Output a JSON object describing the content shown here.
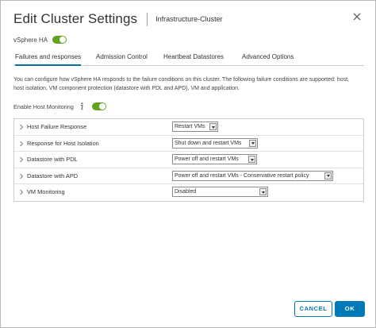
{
  "dialog": {
    "title": "Edit Cluster Settings",
    "subtitle": "Infrastructure-Cluster",
    "close_icon": "close-icon"
  },
  "vsphere_ha": {
    "label": "vSphere HA",
    "enabled": true
  },
  "tabs": [
    {
      "label": "Failures and responses",
      "active": true
    },
    {
      "label": "Admission Control",
      "active": false
    },
    {
      "label": "Heartbeat Datastores",
      "active": false
    },
    {
      "label": "Advanced Options",
      "active": false
    }
  ],
  "description": "You can configure how vSphere HA responds to the failure conditions on this cluster. The following failure conditions are supported: host, host isolation, VM component protection (datastore with PDL and APD), VM and application.",
  "host_monitoring": {
    "label": "Enable Host Monitoring",
    "info_icon": "info-icon",
    "enabled": true
  },
  "responses": [
    {
      "label": "Host Failure Response",
      "value": "Restart VMs"
    },
    {
      "label": "Response for Host Isolation",
      "value": "Shut down and restart VMs"
    },
    {
      "label": "Datastore with PDL",
      "value": "Power off and restart VMs"
    },
    {
      "label": "Datastore with APD",
      "value": "Power off and restart VMs - Conservative restart policy"
    },
    {
      "label": "VM Monitoring",
      "value": "Disabled"
    }
  ],
  "footer": {
    "cancel_label": "CANCEL",
    "ok_label": "OK"
  },
  "colors": {
    "accent": "#0079b8",
    "toggle_on": "#62a420"
  }
}
